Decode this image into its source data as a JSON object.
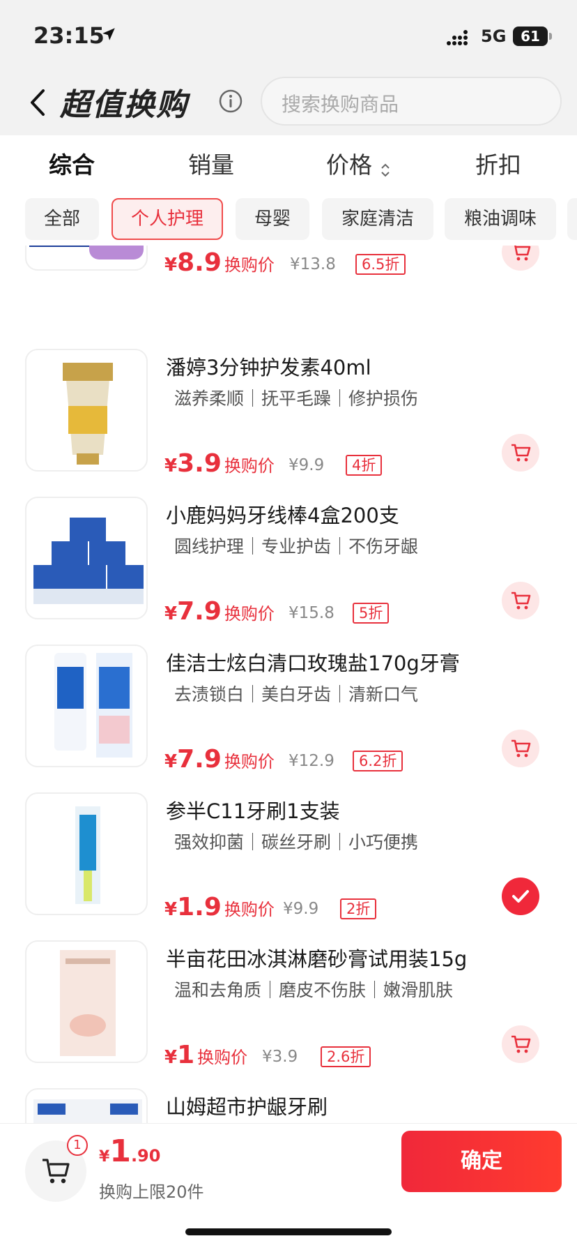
{
  "status_bar": {
    "time": "23:15",
    "network": "5G",
    "battery": "61"
  },
  "header": {
    "title": "超值换购",
    "search_placeholder": "搜索换购商品"
  },
  "sort_tabs": [
    {
      "label": "综合",
      "active": true
    },
    {
      "label": "销量"
    },
    {
      "label": "价格"
    },
    {
      "label": "折扣"
    }
  ],
  "categories": [
    {
      "label": "全部"
    },
    {
      "label": "个人护理",
      "active": true
    },
    {
      "label": "母婴"
    },
    {
      "label": "家庭清洁"
    },
    {
      "label": "粮油调味"
    }
  ],
  "price_label": "换购价",
  "products": [
    {
      "name": "",
      "tags": "",
      "price_yen": "¥",
      "price": "8.9",
      "original": "¥13.8",
      "discount": "6.5折",
      "in_cart": false
    },
    {
      "name": "潘婷3分钟护发素40ml",
      "tags": "滋养柔顺｜抚平毛躁｜修护损伤",
      "price_yen": "¥",
      "price": "3.9",
      "original": "¥9.9",
      "discount": "4折",
      "in_cart": false
    },
    {
      "name": "小鹿妈妈牙线棒4盒200支",
      "tags": "圆线护理｜专业护齿｜不伤牙龈",
      "price_yen": "¥",
      "price": "7.9",
      "original": "¥15.8",
      "discount": "5折",
      "in_cart": false
    },
    {
      "name": "佳洁士炫白清口玫瑰盐170g牙膏",
      "tags": "去渍锁白｜美白牙齿｜清新口气",
      "price_yen": "¥",
      "price": "7.9",
      "original": "¥12.9",
      "discount": "6.2折",
      "in_cart": false
    },
    {
      "name": "参半C11牙刷1支装",
      "tags": "强效抑菌｜碳丝牙刷｜小巧便携",
      "price_yen": "¥",
      "price": "1.9",
      "original": "¥9.9",
      "discount": "2折",
      "in_cart": true
    },
    {
      "name": "半亩花田冰淇淋磨砂膏试用装15g",
      "tags": "温和去角质｜磨皮不伤肤｜嫩滑肌肤",
      "price_yen": "¥",
      "price": "1",
      "original": "¥3.9",
      "discount": "2.6折",
      "in_cart": false
    },
    {
      "name": "山姆超市护龈牙刷",
      "tags": "",
      "price_yen": "",
      "price": "",
      "original": "",
      "discount": "",
      "in_cart": false
    }
  ],
  "bottom_bar": {
    "cart_count": "1",
    "total_yen": "¥",
    "total_int": "1",
    "total_dec": ".90",
    "limit_text": "换购上限20件",
    "confirm_label": "确定"
  },
  "colors": {
    "accent": "#e8303c",
    "accent_bg": "#fde6e6"
  }
}
